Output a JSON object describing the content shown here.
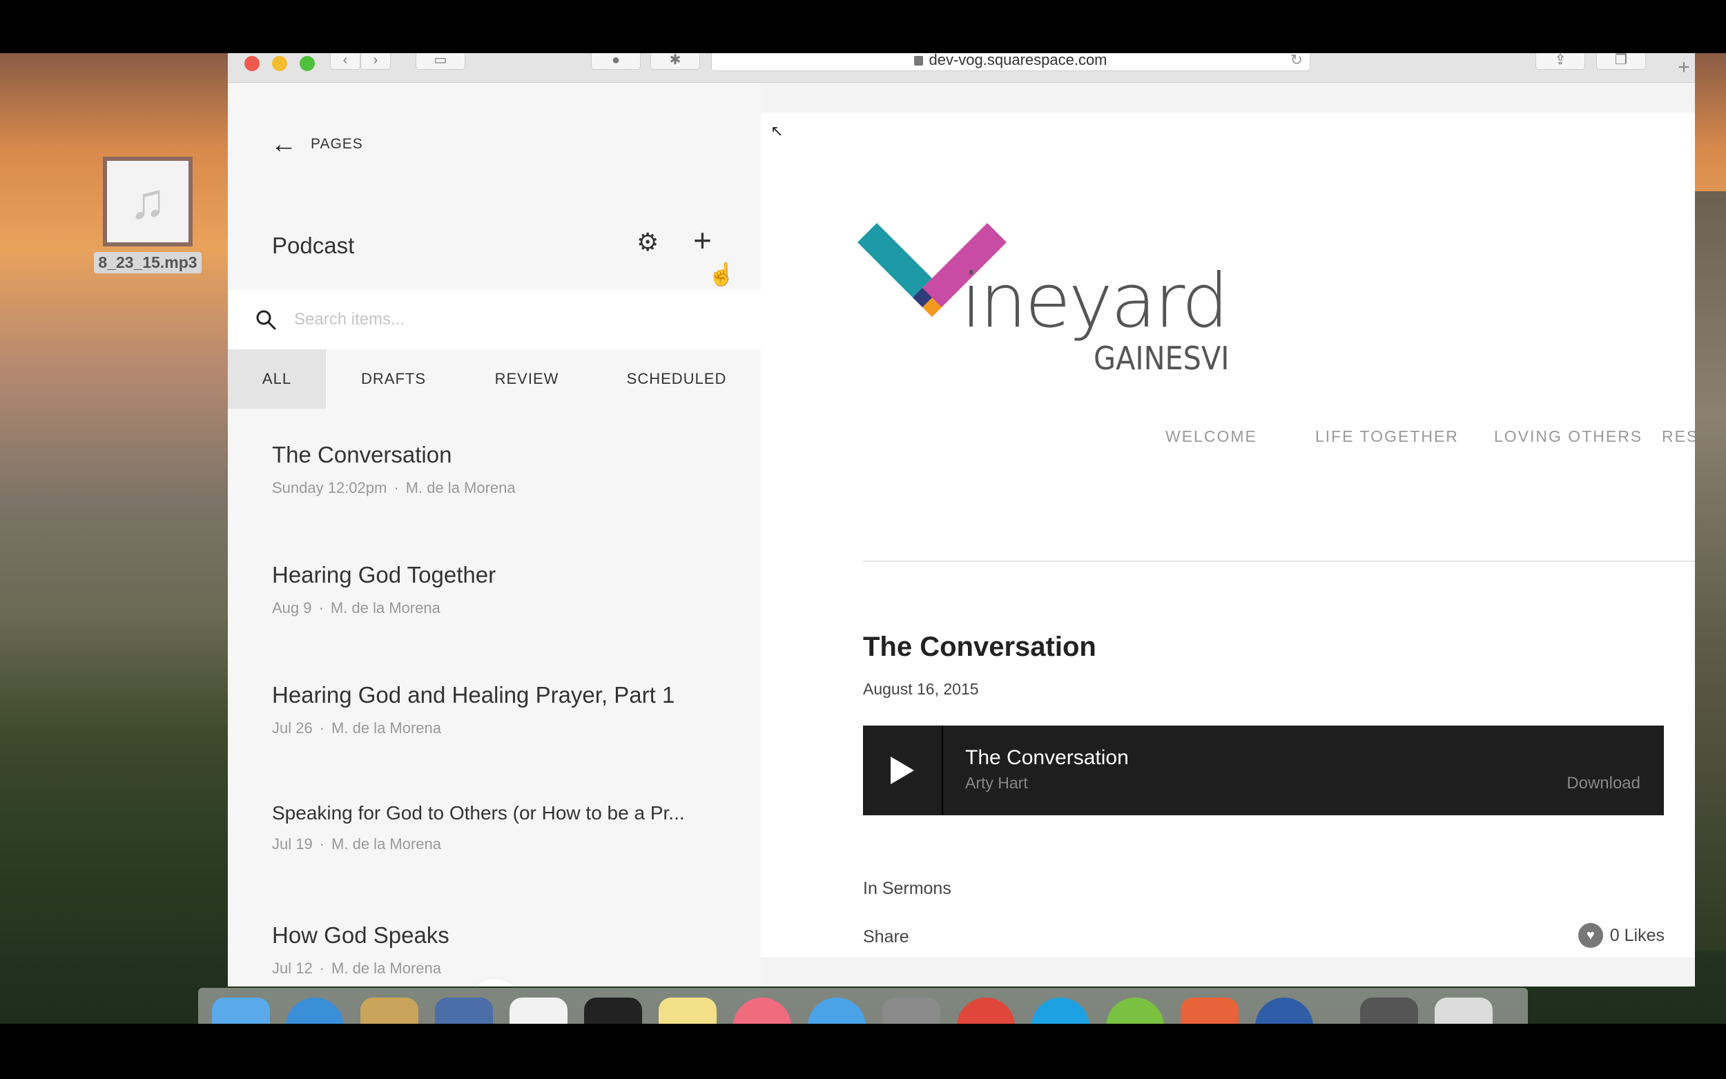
{
  "desktop": {
    "file_name": "8_23_15.mp3",
    "file_icon": "music-note-icon"
  },
  "browser": {
    "url": "dev-vog.squarespace.com"
  },
  "panel": {
    "back_label": "PAGES",
    "title": "Podcast",
    "search_placeholder": "Search items...",
    "tabs": [
      {
        "label": "ALL",
        "active": true
      },
      {
        "label": "DRAFTS",
        "active": false
      },
      {
        "label": "REVIEW",
        "active": false
      },
      {
        "label": "SCHEDULED",
        "active": false
      }
    ],
    "items": [
      {
        "title": "The Conversation",
        "date": "Sunday 12:02pm",
        "author": "M. de la Morena"
      },
      {
        "title": "Hearing God Together",
        "date": "Aug 9",
        "author": "M. de la Morena"
      },
      {
        "title": "Hearing God and Healing Prayer, Part 1",
        "date": "Jul 26",
        "author": "M. de la Morena"
      },
      {
        "title": "Speaking for God to Others (or How to be a Pr...",
        "date": "Jul 19",
        "author": "M. de la Morena"
      },
      {
        "title": "How God Speaks",
        "date": "Jul 12",
        "author": "M. de la Morena"
      }
    ]
  },
  "preview": {
    "logo": {
      "word": "ineyard",
      "sub": "GAINESVILLE"
    },
    "nav": [
      "WELCOME",
      "LIFE TOGETHER",
      "LOVING OTHERS",
      "RESOU"
    ],
    "post_title": "The Conversation",
    "post_date": "August 16, 2015",
    "player": {
      "track": "The Conversation",
      "artist": "Arty Hart",
      "download": "Download"
    },
    "category": "In Sermons",
    "share": "Share",
    "likes": "0 Likes"
  },
  "colors": {
    "logo_teal": "#1e9aa6",
    "logo_magenta": "#c2399a",
    "logo_orange": "#f29a1f",
    "player_bg": "#1e1e1e"
  }
}
